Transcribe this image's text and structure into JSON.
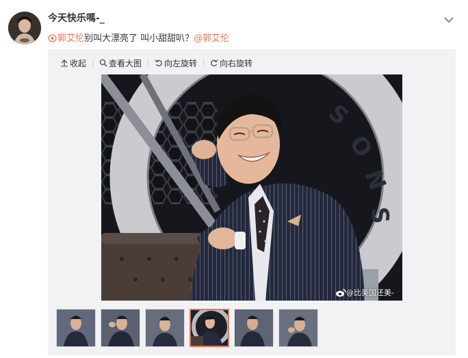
{
  "post": {
    "username": "今天快乐嗎-_",
    "mention1": "郭艾伦",
    "body_text": "别叫大漂亮了 叫小甜甜叭？",
    "mention2": "@郭艾伦"
  },
  "toolbar": {
    "collapse_label": "收起",
    "view_large_label": "查看大图",
    "rotate_left_label": "向左旋转",
    "rotate_right_label": "向右旋转"
  },
  "image": {
    "watermark": "@比美国还美-"
  },
  "thumbnails": {
    "count": 6,
    "active_index": 3
  },
  "colors": {
    "accent": "#eb7350",
    "panel_bg": "#f2f2f5",
    "link": "#eb7350"
  }
}
